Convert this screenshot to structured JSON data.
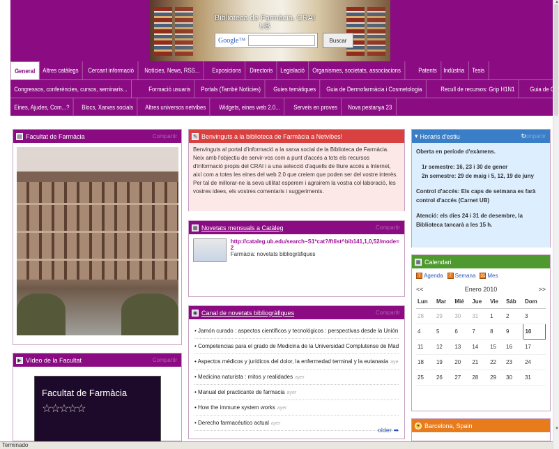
{
  "header": {
    "banner_title": "Biblioteca de Farmàcia. CRAI UB",
    "google_logo": "Google™",
    "search_placeholder": "",
    "search_button": "Buscar"
  },
  "tabs": {
    "row1": [
      "General",
      "Altres catàlegs",
      "Cercant informació",
      "Notícies, News, RSS...",
      "Exposicions",
      "Directoris",
      "Legislació",
      "Organismes, societats, associacions",
      "Patents",
      "Indústria",
      "Tesis"
    ],
    "row2": [
      "Congressos, conferències, cursos, seminaris...",
      "Formació usuaris",
      "Portals (També Notícies)",
      "Guies temàtiques",
      "Guia de Dermofarmàcia i Cosmetologia",
      "Recull de recursos: Grip H1N1",
      "Guia de Ciència i Tecnologia dels Aliments"
    ],
    "row3": [
      "Eines, Ajudes, Com...?",
      "Blocs, Xarxes socials",
      "Altres universos netvibes",
      "Widgets, eines web 2.0...",
      "Serveis en proves",
      "Nova pestanya 23"
    ]
  },
  "widgets": {
    "facultat": {
      "title": "Facultat de Farmàcia",
      "edit": "Compartir"
    },
    "video": {
      "title": "Vídeo de la Facultat",
      "edit": "Compartir",
      "video_title": "Facultat de Farmàcia",
      "stars": "☆☆☆☆☆"
    },
    "welcome": {
      "title": "Benvinguts a la biblioteca de Farmàcia a Netvibes!",
      "p1": "Benvinguts al portal d'informació a la xarxa social de la Biblioteca de Farmàcia.",
      "p2": "Neix amb l'objectiu de servir-vos com a punt d'accés a tots els recursos d'informació propis del CRAI i a una selecció d'aquells de lliure accés a Internet, així com a totes les eines del web 2.0 que creiem que poden ser del vostre interès.",
      "p3": "Per tal de millorar-ne la seva utilitat esperem i agrairem la vostra col·laboració, les vostres idees, els vostres comentaris i suggeriments."
    },
    "novetats": {
      "title": "Novetats mensuals a Catàleg",
      "edit": "Compartir",
      "link": "http://cataleg.ub.edu/search~S1*cat?/ftlist^bib141,1,0,52/mode=2",
      "desc": "Farmàcia: novetats bibliogràfiques"
    },
    "canal": {
      "title": "Canal de novetats bibliogràfiques",
      "edit": "Compartir",
      "items": [
        {
          "t": "Jamón curado : aspectos científicos y tecnológicos : perspectivas desde la Unión Europea",
          "age": "ayer"
        },
        {
          "t": "Competencias para el grado de Medicina de la Universidad Complutense de Madrid : documento base",
          "age": "ayer"
        },
        {
          "t": "Aspectos médicos y jurídicos del dolor, la enfermedad terminal y la eutanasia",
          "age": "ayer"
        },
        {
          "t": "Medicina naturista : mitos y realidades",
          "age": "ayer"
        },
        {
          "t": "Manual del practicante de farmacia",
          "age": "ayer"
        },
        {
          "t": "How the immune system works",
          "age": "ayer"
        },
        {
          "t": "Derecho farmacéutico actual",
          "age": "ayer"
        }
      ],
      "older": "older"
    },
    "horaris": {
      "title": "Horaris d'estiu",
      "edit": "Compartir",
      "l1": "Oberta en període d'exàmens.",
      "l2": "1r semestre:  16, 23 i 30 de gener",
      "l3": "2n semestre:  29 de maig  i  5, 12, 19 de juny",
      "l4": "Control d'accés: Els caps de setmana es farà control d'accés (Carnet UB)",
      "l5": "Atenció: els dies 24 i 31 de desembre, la Biblioteca tancarà a les 15 h."
    },
    "calendari": {
      "title": "Calendari",
      "views": [
        "Agenda",
        "Semana",
        "Mes"
      ],
      "prev": "<<",
      "next": ">>",
      "month": "Enero 2010",
      "days": [
        "Lun",
        "Mar",
        "Mié",
        "Jue",
        "Vie",
        "Sáb",
        "Dom"
      ],
      "weeks": [
        [
          "28",
          "29",
          "30",
          "31",
          "1",
          "2",
          "3"
        ],
        [
          "4",
          "5",
          "6",
          "7",
          "8",
          "9",
          "10"
        ],
        [
          "11",
          "12",
          "13",
          "14",
          "15",
          "16",
          "17"
        ],
        [
          "18",
          "19",
          "20",
          "21",
          "22",
          "23",
          "24"
        ],
        [
          "25",
          "26",
          "27",
          "28",
          "29",
          "30",
          "31"
        ]
      ]
    },
    "barcelona": {
      "title": "Barcelona, Spain"
    }
  },
  "status": {
    "text": "Terminado"
  }
}
